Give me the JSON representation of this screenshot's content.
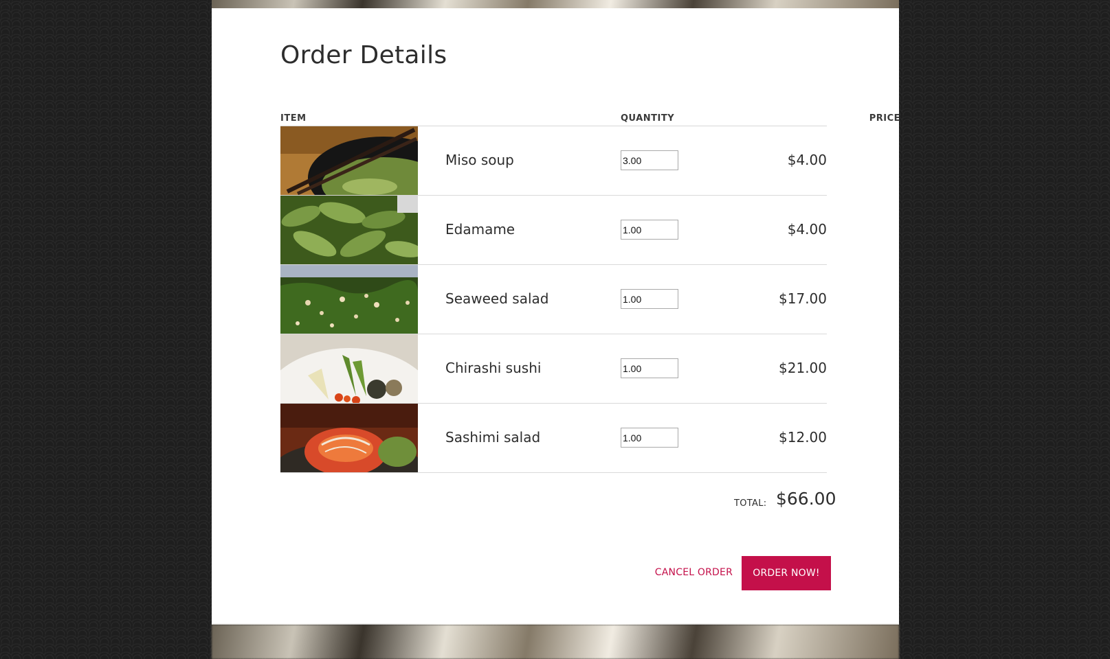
{
  "modal": {
    "title": "Order Details",
    "columns": {
      "item": "ITEM",
      "quantity": "QUANTITY",
      "price": "PRICE"
    },
    "items": [
      {
        "name": "Miso soup",
        "quantity": "3.00",
        "price": "$4.00",
        "image": "miso-soup-image"
      },
      {
        "name": "Edamame",
        "quantity": "1.00",
        "price": "$4.00",
        "image": "edamame-image"
      },
      {
        "name": "Seaweed salad",
        "quantity": "1.00",
        "price": "$17.00",
        "image": "seaweed-salad-image"
      },
      {
        "name": "Chirashi sushi",
        "quantity": "1.00",
        "price": "$21.00",
        "image": "chirashi-sushi-image"
      },
      {
        "name": "Sashimi salad",
        "quantity": "1.00",
        "price": "$12.00",
        "image": "sashimi-salad-image"
      }
    ],
    "total": {
      "label": "TOTAL:",
      "value": "$66.00"
    },
    "actions": {
      "cancel_label": "CANCEL ORDER",
      "order_label": "ORDER NOW!"
    },
    "colors": {
      "accent": "#c4104a",
      "background": "#1e1e1e",
      "panel": "#ffffff"
    }
  }
}
